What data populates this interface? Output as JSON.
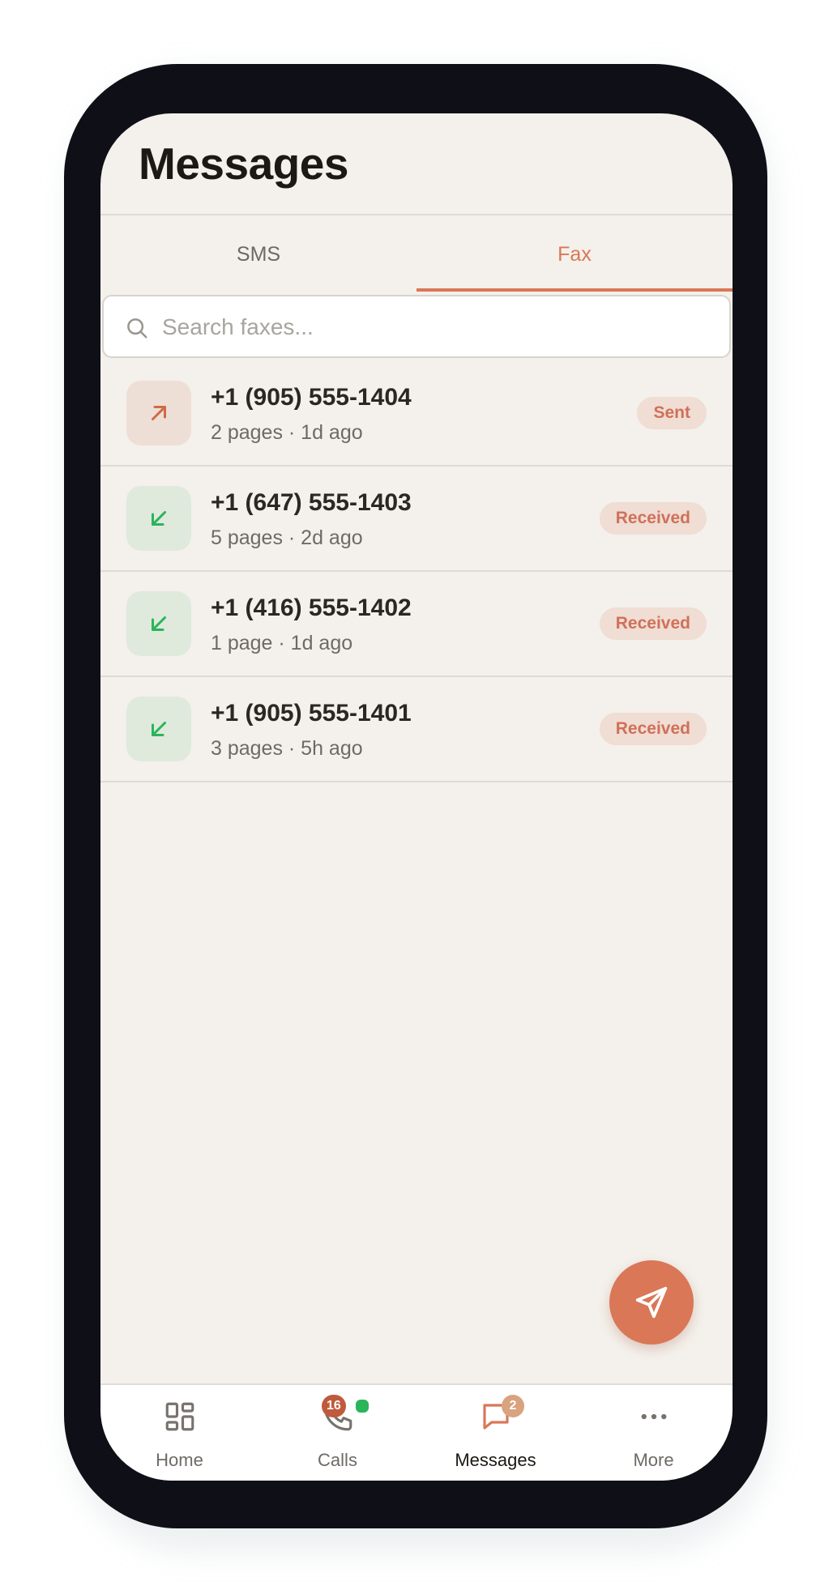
{
  "header": {
    "title": "Messages"
  },
  "tabs": [
    {
      "label": "SMS",
      "active": false
    },
    {
      "label": "Fax",
      "active": true
    }
  ],
  "search": {
    "placeholder": "Search faxes..."
  },
  "faxes": [
    {
      "number": "+1 (905) 555-1404",
      "meta": "2 pages · 1d ago",
      "status": "Sent",
      "direction": "outgoing"
    },
    {
      "number": "+1 (647) 555-1403",
      "meta": "5 pages · 2d ago",
      "status": "Received",
      "direction": "incoming"
    },
    {
      "number": "+1 (416) 555-1402",
      "meta": "1 page · 1d ago",
      "status": "Received",
      "direction": "incoming"
    },
    {
      "number": "+1 (905) 555-1401",
      "meta": "3 pages · 5h ago",
      "status": "Received",
      "direction": "incoming"
    }
  ],
  "fab": {
    "icon": "send-icon"
  },
  "nav": {
    "items": [
      {
        "label": "Home",
        "icon": "grid-icon"
      },
      {
        "label": "Calls",
        "icon": "phone-icon",
        "badge": "16"
      },
      {
        "label": "Messages",
        "icon": "chat-bubble-icon",
        "badge": "2",
        "active": true
      },
      {
        "label": "More",
        "icon": "more-dots-icon"
      }
    ]
  },
  "colors": {
    "accent": "#d97757",
    "background": "#f4f0eb",
    "sent_icon": "#d06a48",
    "received_icon": "#2bb45a",
    "presence": "#2bb45a"
  }
}
